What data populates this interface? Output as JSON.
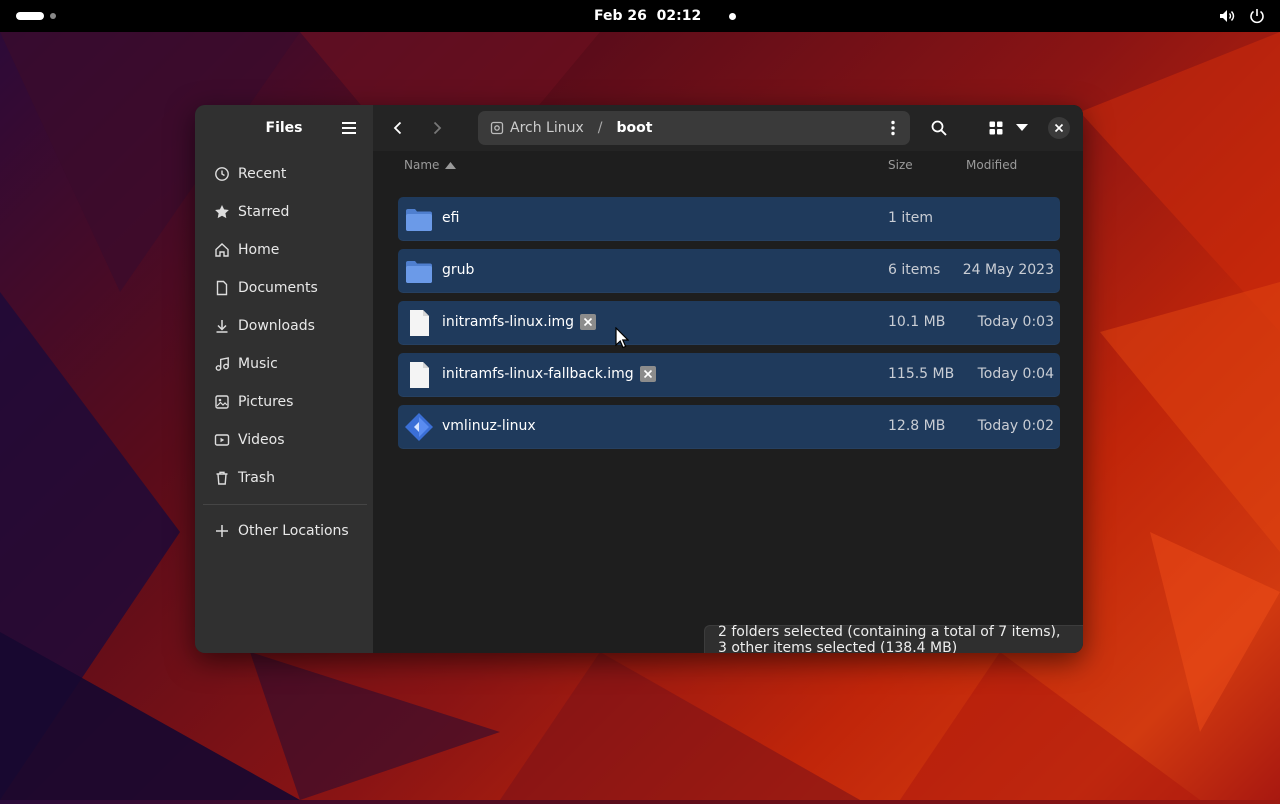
{
  "topbar": {
    "clock": "Feb 26  02:12"
  },
  "sidebar": {
    "title": "Files",
    "items": [
      {
        "label": "Recent",
        "icon": "clock-icon"
      },
      {
        "label": "Starred",
        "icon": "star-icon"
      },
      {
        "label": "Home",
        "icon": "home-icon"
      },
      {
        "label": "Documents",
        "icon": "document-icon"
      },
      {
        "label": "Downloads",
        "icon": "download-icon"
      },
      {
        "label": "Music",
        "icon": "music-icon"
      },
      {
        "label": "Pictures",
        "icon": "picture-icon"
      },
      {
        "label": "Videos",
        "icon": "video-icon"
      },
      {
        "label": "Trash",
        "icon": "trash-icon"
      }
    ],
    "other_locations": "Other Locations"
  },
  "header": {
    "path_root": "Arch Linux",
    "path_sep": "/",
    "path_current": "boot"
  },
  "columns": {
    "name": "Name",
    "size": "Size",
    "modified": "Modified"
  },
  "files": [
    {
      "name": "efi",
      "type": "folder",
      "size": "1 item",
      "modified": ""
    },
    {
      "name": "grub",
      "type": "folder",
      "size": "6 items",
      "modified": "24 May 2023"
    },
    {
      "name": "initramfs-linux.img",
      "type": "file",
      "size": "10.1 MB",
      "modified": "Today 0:03",
      "badge": true
    },
    {
      "name": "initramfs-linux-fallback.img",
      "type": "file",
      "size": "115.5 MB",
      "modified": "Today 0:04",
      "badge": true
    },
    {
      "name": "vmlinuz-linux",
      "type": "kernel",
      "size": "12.8 MB",
      "modified": "Today 0:02"
    }
  ],
  "status": "2 folders selected (containing a total of 7 items), 3 other items selected (138.4 MB)",
  "colors": {
    "selection": "#1f3a5c",
    "folder": "#6b9ae8",
    "window_bg": "#1e1e1e",
    "sidebar_bg": "#303030"
  }
}
